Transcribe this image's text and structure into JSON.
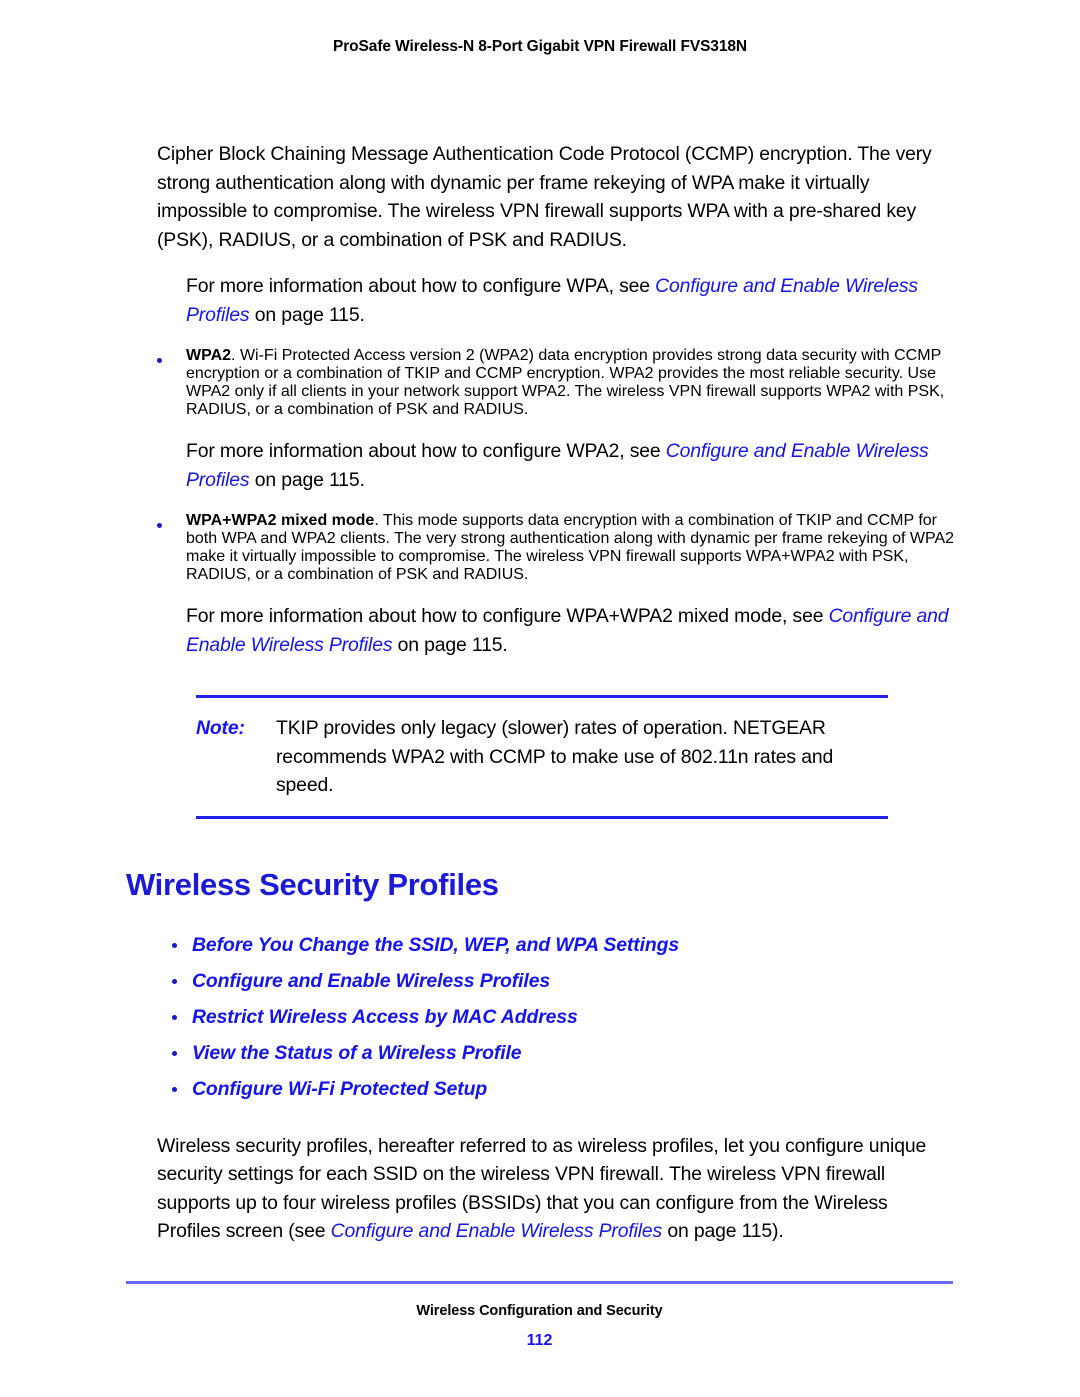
{
  "header": {
    "title": "ProSafe Wireless-N 8-Port Gigabit VPN Firewall FVS318N"
  },
  "colors": {
    "link_blue": "#1414ee",
    "heading_blue": "#1a1ad8",
    "rule_blue": "#2222ee",
    "footer_rule_blue": "#6a6aff",
    "bullet_blue": "#1414dd",
    "body_text": "#000000"
  },
  "body": {
    "intro_paragraph": "Cipher Block Chaining Message Authentication Code Protocol (CCMP) encryption. The very strong authentication along with dynamic per frame rekeying of WPA make it virtually impossible to compromise. The wireless VPN firewall supports WPA with a pre-shared key (PSK), RADIUS, or a combination of PSK and RADIUS.",
    "wpa_xref": {
      "lead": "For more information about how to configure WPA, see ",
      "link": "Configure and Enable Wireless Profiles",
      "tail": " on page 115."
    },
    "wpa2_bullet": {
      "term": "WPA2",
      "text": ". Wi-Fi Protected Access version 2 (WPA2) data encryption provides strong data security with CCMP encryption or a combination of TKIP and CCMP encryption. WPA2 provides the most reliable security. Use WPA2 only if all clients in your network support WPA2. The wireless VPN firewall supports WPA2 with PSK, RADIUS, or a combination of PSK and RADIUS."
    },
    "wpa2_xref": {
      "lead": "For more information about how to configure WPA2, see ",
      "link": "Configure and Enable Wireless Profiles",
      "tail": " on page 115."
    },
    "mixed_bullet": {
      "term": "WPA+WPA2 mixed mode",
      "text": ". This mode supports data encryption with a combination of TKIP and CCMP for both WPA and WPA2 clients. The very strong authentication along with dynamic per frame rekeying of WPA2 make it virtually impossible to compromise. The wireless VPN firewall supports WPA+WPA2 with PSK, RADIUS, or a combination of PSK and RADIUS."
    },
    "mixed_xref": {
      "lead": "For more information about how to configure WPA+WPA2 mixed mode, see ",
      "link": "Configure and Enable Wireless Profiles",
      "tail": " on page 115."
    }
  },
  "note": {
    "label": "Note:",
    "text": "TKIP provides only legacy (slower) rates of operation. NETGEAR recommends WPA2 with CCMP to make use of 802.11n rates and speed."
  },
  "section": {
    "heading": "Wireless Security Profiles",
    "links": [
      "Before You Change the SSID, WEP, and WPA Settings",
      "Configure and Enable Wireless Profiles",
      "Restrict Wireless Access by MAC Address",
      "View the Status of a Wireless Profile",
      "Configure Wi-Fi Protected Setup"
    ],
    "closing": {
      "lead": "Wireless security profiles, hereafter referred to as wireless profiles, let you configure unique security settings for each SSID on the wireless VPN firewall. The wireless VPN firewall supports up to four wireless profiles (BSSIDs) that you can configure from the Wireless Profiles screen (see ",
      "link": "Configure and Enable Wireless Profiles",
      "tail": " on page 115)."
    }
  },
  "footer": {
    "chapter": "Wireless Configuration and Security",
    "page_number": "112"
  }
}
